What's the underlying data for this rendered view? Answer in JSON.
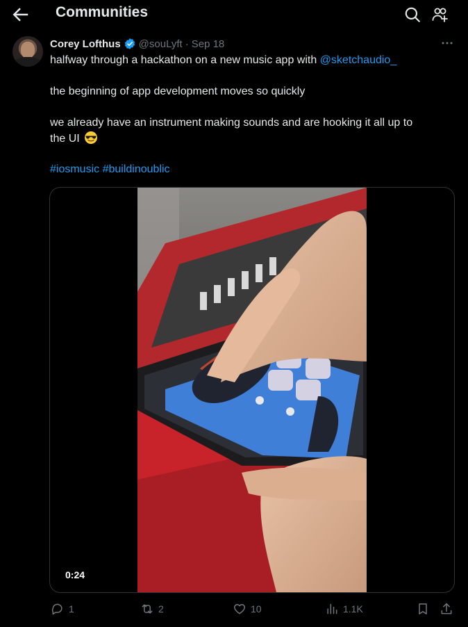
{
  "header": {
    "title": "Communities",
    "back_icon": "arrow-left-icon",
    "search_icon": "search-icon",
    "members_icon": "people-add-icon"
  },
  "tweet": {
    "author_name": "Corey Lofthus",
    "handle": "@souLyft",
    "separator": "·",
    "date": "Sep 18",
    "verified": true,
    "text_line1_prefix": "halfway through a hackathon on a new music app with ",
    "mention": "@sketchaudio_",
    "text_line2": "the beginning of app development moves so quickly",
    "text_line3": "we already have an instrument making sounds and are hooking it all up to",
    "text_line4": "the UI",
    "emoji": "smiling-face-with-sunglasses-icon",
    "hashtags": [
      "#iosmusic",
      "#buildinoublic"
    ]
  },
  "media": {
    "type": "video",
    "duration": "0:24"
  },
  "actions": {
    "replies": "1",
    "reposts": "2",
    "likes": "10",
    "views": "1.1K"
  },
  "colors": {
    "background": "#000000",
    "text": "#e7e9ea",
    "secondary_text": "#71767b",
    "accent": "#1d9bf0",
    "border": "#2f3336"
  }
}
